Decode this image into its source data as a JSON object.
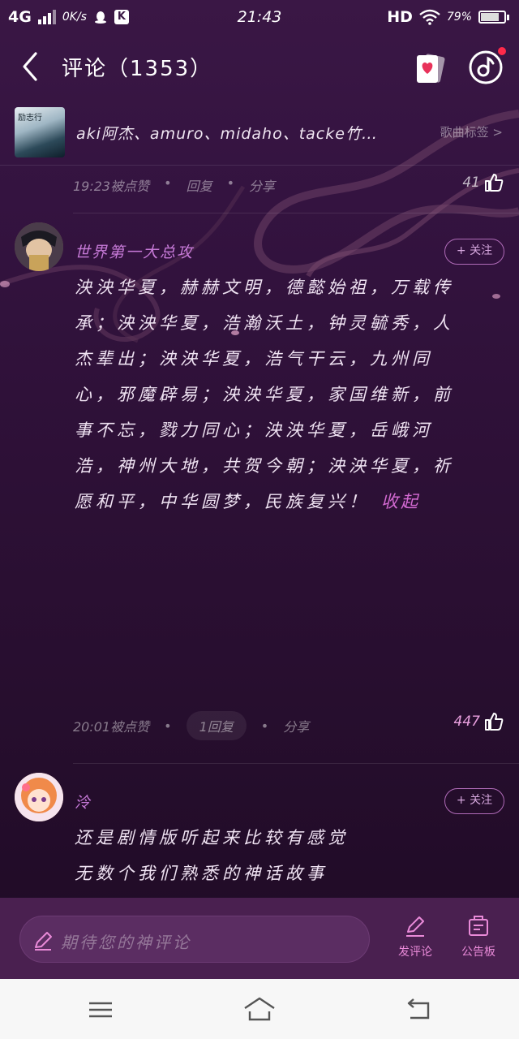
{
  "status_bar": {
    "network": "4G",
    "speed": "0K/s",
    "k_icon": "K",
    "time": "21:43",
    "hd": "HD",
    "battery": "79%",
    "battery_level": 0.79
  },
  "header": {
    "title": "评论（1353）"
  },
  "song_row": {
    "cover_text": "励志行",
    "names": "aki阿杰、amuro、midaho、tacke竹…",
    "tag": "歌曲标签 >"
  },
  "comment_top": {
    "meta": "19:23被点赞",
    "reply": "回复",
    "share": "分享",
    "likes": "41"
  },
  "comment_main": {
    "username": "世界第一大总攻",
    "follow": "+ 关注",
    "text": "泱泱华夏，赫赫文明，德懿始祖，万载传承；泱泱华夏，浩瀚沃土，钟灵毓秀，人杰辈出；泱泱华夏，浩气干云，九州同心，邪魔辟易；泱泱华夏，家国维新，前事不忘，戮力同心；泱泱华夏，岳峨河浩，神州大地，共贺今朝；泱泱华夏，祈愿和平，中华圆梦，民族复兴！",
    "collapse": "收起",
    "meta": "20:01被点赞",
    "reply": "1回复",
    "share": "分享",
    "likes": "447"
  },
  "comment_next": {
    "username": "泠",
    "follow": "+ 关注",
    "line1": "还是剧情版听起来比较有感觉",
    "line2": "无数个我们熟悉的神话故事"
  },
  "composer": {
    "placeholder": "期待您的神评论",
    "post_label": "发评论",
    "board_label": "公告板"
  },
  "icons": {
    "back": "chevron-left-icon",
    "card": "heart-card-icon",
    "disc": "music-disc-icon",
    "like": "thumbs-up-icon",
    "pen": "pen-icon",
    "board": "notice-board-icon"
  },
  "colors": {
    "accent": "#d36ad2",
    "username": "#c77ad8",
    "background": "#2a0f32"
  }
}
